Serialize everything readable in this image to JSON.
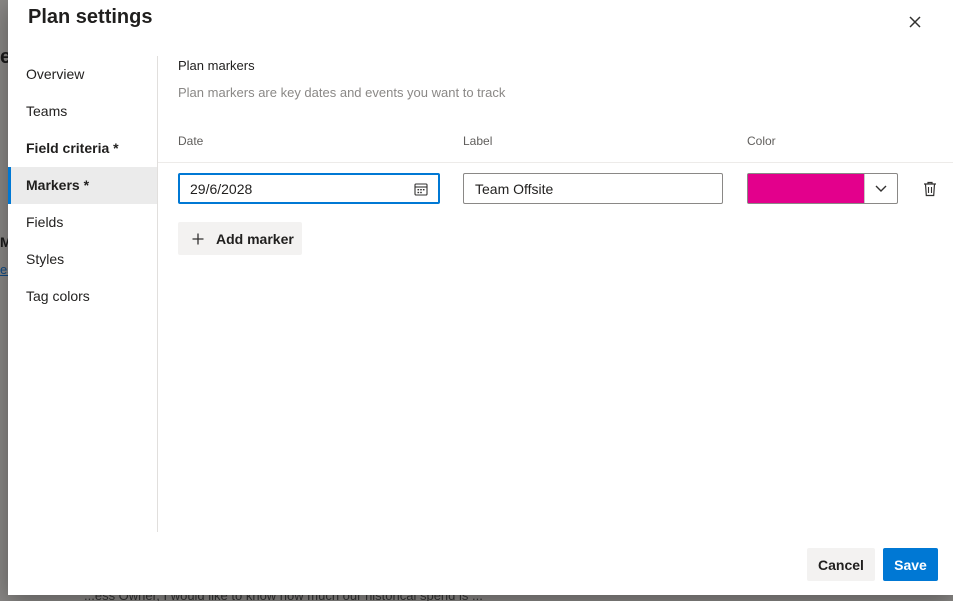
{
  "background": {
    "heading_fragment": "er",
    "letter_fragment": "M",
    "link_fragment": "es",
    "bottom_text": "...ess Owner, I would like to know how much our historical spend is ..."
  },
  "dialog": {
    "title": "Plan settings",
    "close_icon": "close-icon"
  },
  "nav": {
    "items": [
      {
        "label": "Overview",
        "state": "normal"
      },
      {
        "label": "Teams",
        "state": "normal"
      },
      {
        "label": "Field criteria *",
        "state": "modified"
      },
      {
        "label": "Markers *",
        "state": "selected"
      },
      {
        "label": "Fields",
        "state": "normal"
      },
      {
        "label": "Styles",
        "state": "normal"
      },
      {
        "label": "Tag colors",
        "state": "normal"
      }
    ]
  },
  "markers": {
    "section_title": "Plan markers",
    "description": "Plan markers are key dates and events you want to track",
    "columns": {
      "date": "Date",
      "label": "Label",
      "color": "Color"
    },
    "rows": [
      {
        "date": "29/6/2028",
        "label": "Team Offsite",
        "color": "#e3008c"
      }
    ],
    "add_label": "Add marker"
  },
  "footer": {
    "cancel_label": "Cancel",
    "save_label": "Save"
  },
  "colors": {
    "accent": "#0078d4",
    "marker_color": "#e3008c"
  }
}
